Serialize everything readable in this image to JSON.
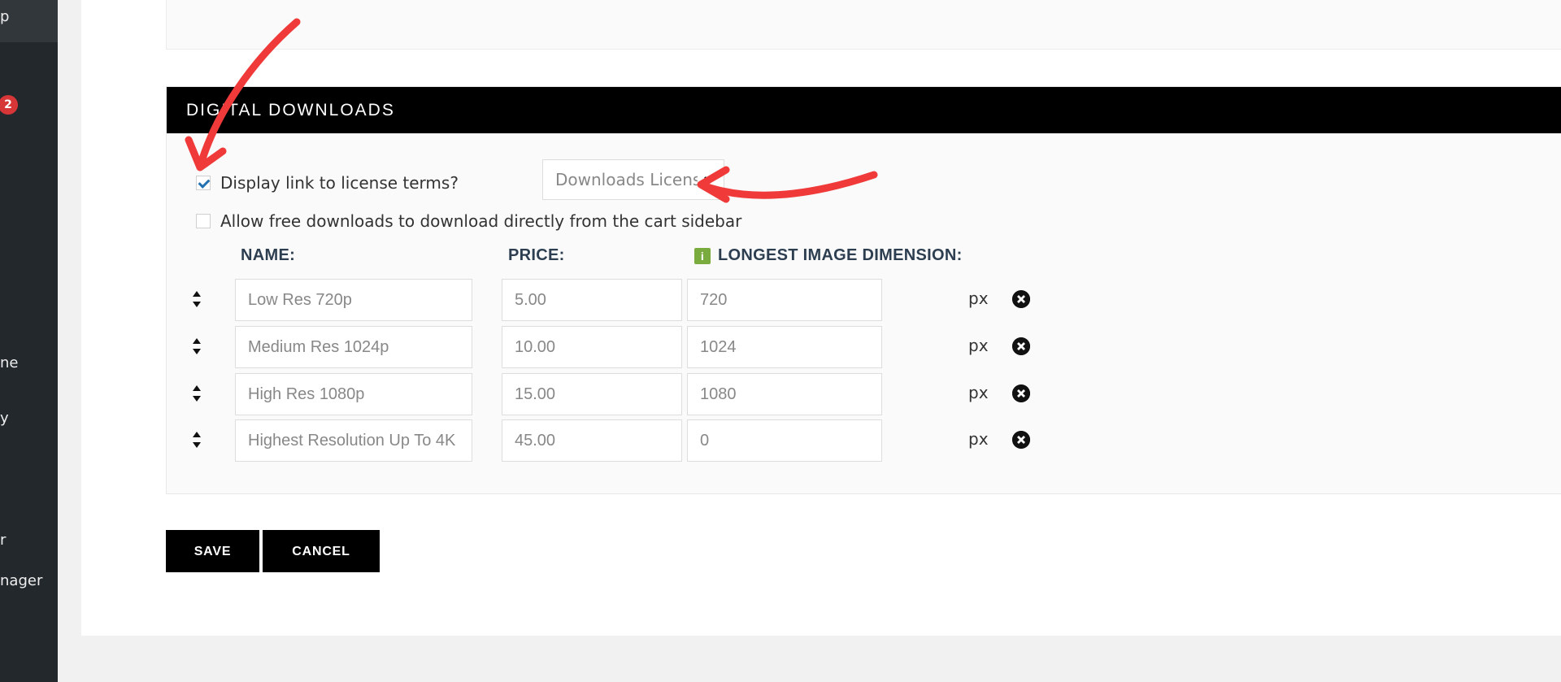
{
  "sidebar": {
    "fragments": [
      "p",
      "ne",
      "y",
      "r",
      "nager"
    ],
    "badge": "2"
  },
  "section": {
    "title": "DIGITAL DOWNLOADS",
    "license_option": {
      "label": "Display link to license terms?",
      "checked": true,
      "select_value": "Downloads License Terms"
    },
    "free_download_option": {
      "label": "Allow free downloads to download directly from the cart sidebar",
      "checked": false
    },
    "columns": {
      "name": "NAME:",
      "price": "PRICE:",
      "dimension": "LONGEST IMAGE DIMENSION:",
      "info_icon": "i"
    },
    "rows": [
      {
        "name": "Low Res 720p",
        "price": "5.00",
        "dimension": "720",
        "unit": "px"
      },
      {
        "name": "Medium Res 1024p",
        "price": "10.00",
        "dimension": "1024",
        "unit": "px"
      },
      {
        "name": "High Res 1080p",
        "price": "15.00",
        "dimension": "1080",
        "unit": "px"
      },
      {
        "name": "Highest Resolution Up To 4K",
        "price": "45.00",
        "dimension": "0",
        "unit": "px"
      }
    ]
  },
  "actions": {
    "save": "SAVE",
    "cancel": "CANCEL"
  },
  "colors": {
    "header_bg": "#000000",
    "annotation_arrow": "#f03a3a",
    "check_blue": "#2271b1",
    "info_green": "#7aab3e",
    "badge_red": "#d63638"
  }
}
